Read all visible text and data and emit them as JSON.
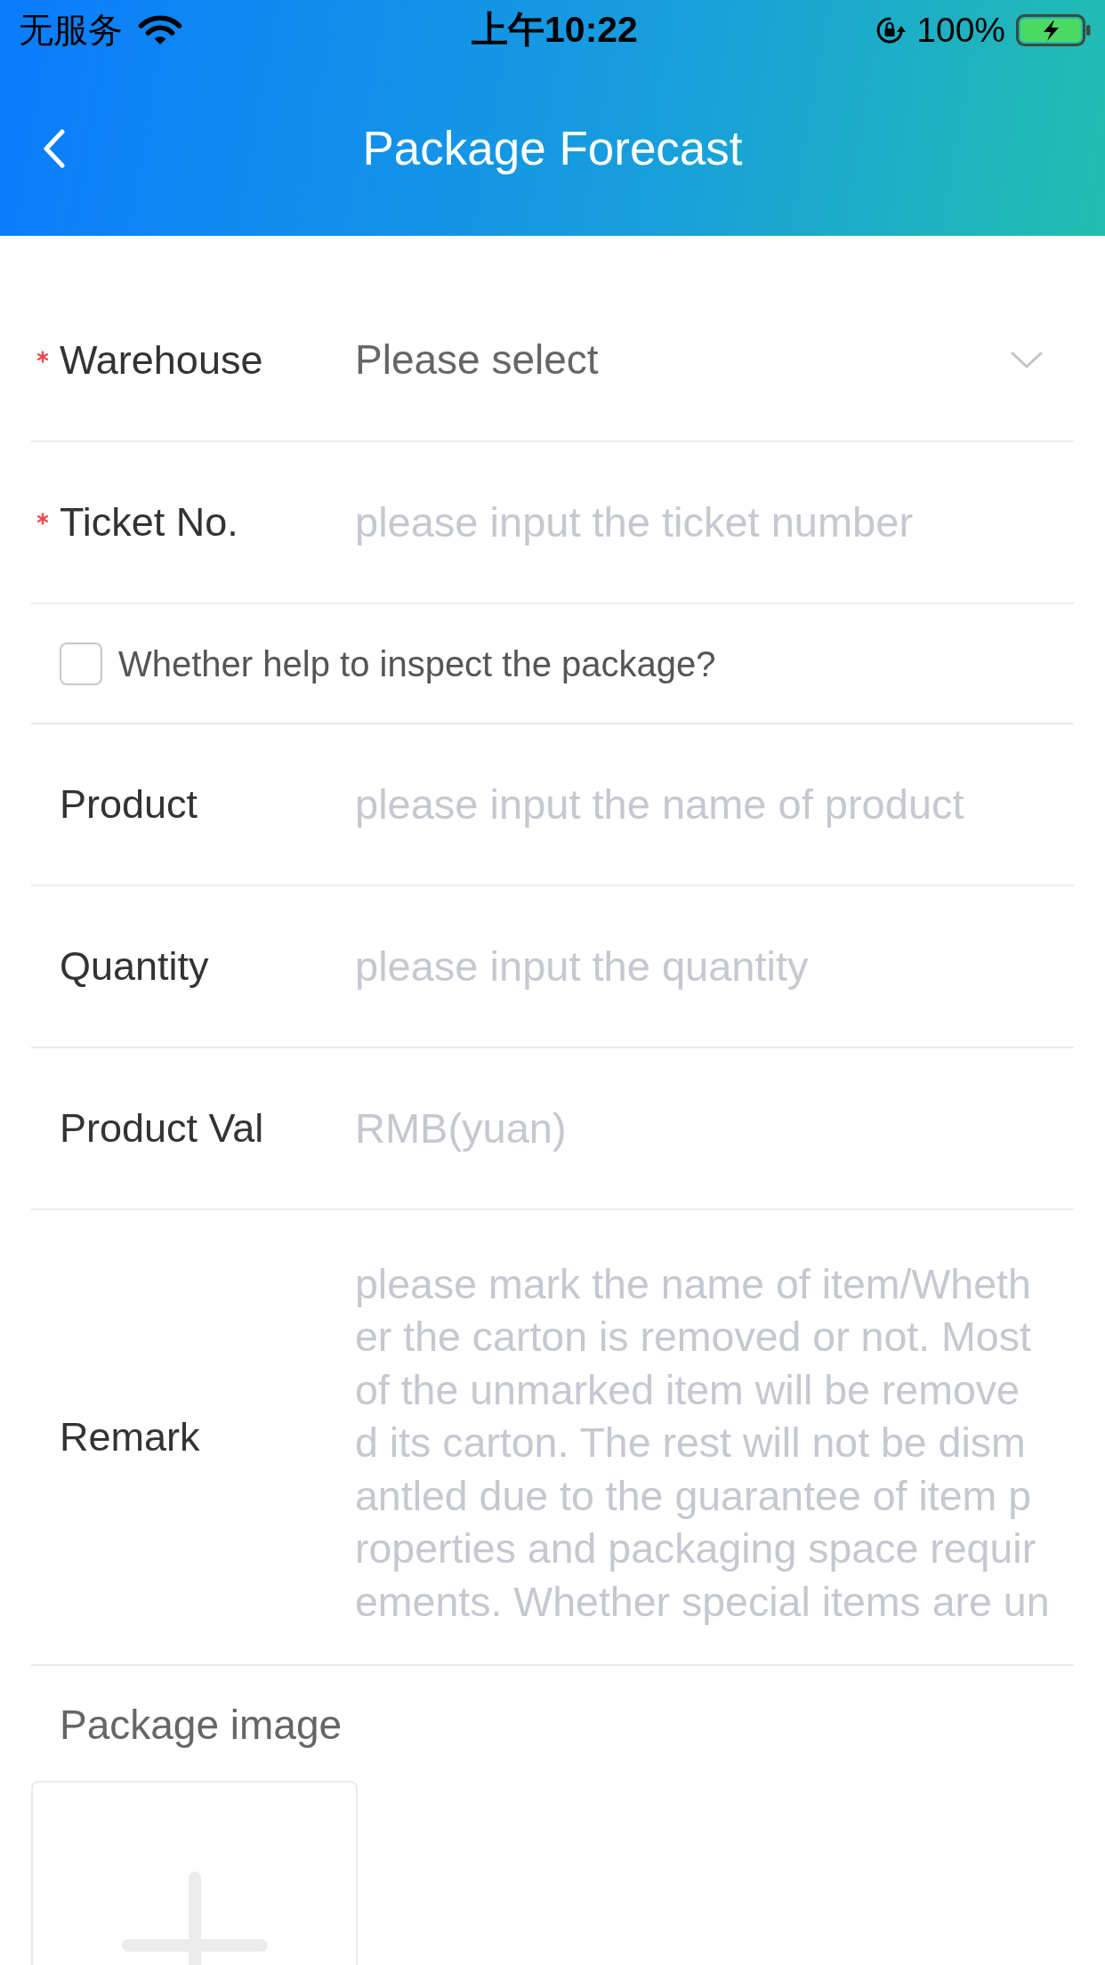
{
  "status_bar": {
    "carrier": "无服务",
    "time": "上午10:22",
    "battery": "100%"
  },
  "nav": {
    "title": "Package Forecast"
  },
  "form": {
    "rows": [
      {
        "kind": "select",
        "label": "Warehouse",
        "required": true,
        "value": "Please select"
      },
      {
        "kind": "input",
        "label": "Ticket No.",
        "required": true,
        "placeholder": "please input the ticket number"
      },
      {
        "kind": "checkbox",
        "label": "Whether help to inspect the package?",
        "checked": false
      },
      {
        "kind": "input",
        "label": "Product",
        "required": false,
        "placeholder": "please input the name of product"
      },
      {
        "kind": "input",
        "label": "Quantity",
        "required": false,
        "placeholder": "please input the quantity"
      },
      {
        "kind": "input",
        "label": "Product Val",
        "required": false,
        "placeholder": "RMB(yuan)"
      },
      {
        "kind": "textarea",
        "label": "Remark",
        "required": false,
        "placeholder": "please mark the name of item/Wheth\ner the carton is removed or not. Most\nof the unmarked item will be remove\nd its carton. The rest will not be dism\nantled due to the guarantee of item p\nroperties and packaging space requir\nements. Whether special items are un"
      }
    ]
  },
  "package_image": {
    "label": "Package image"
  }
}
